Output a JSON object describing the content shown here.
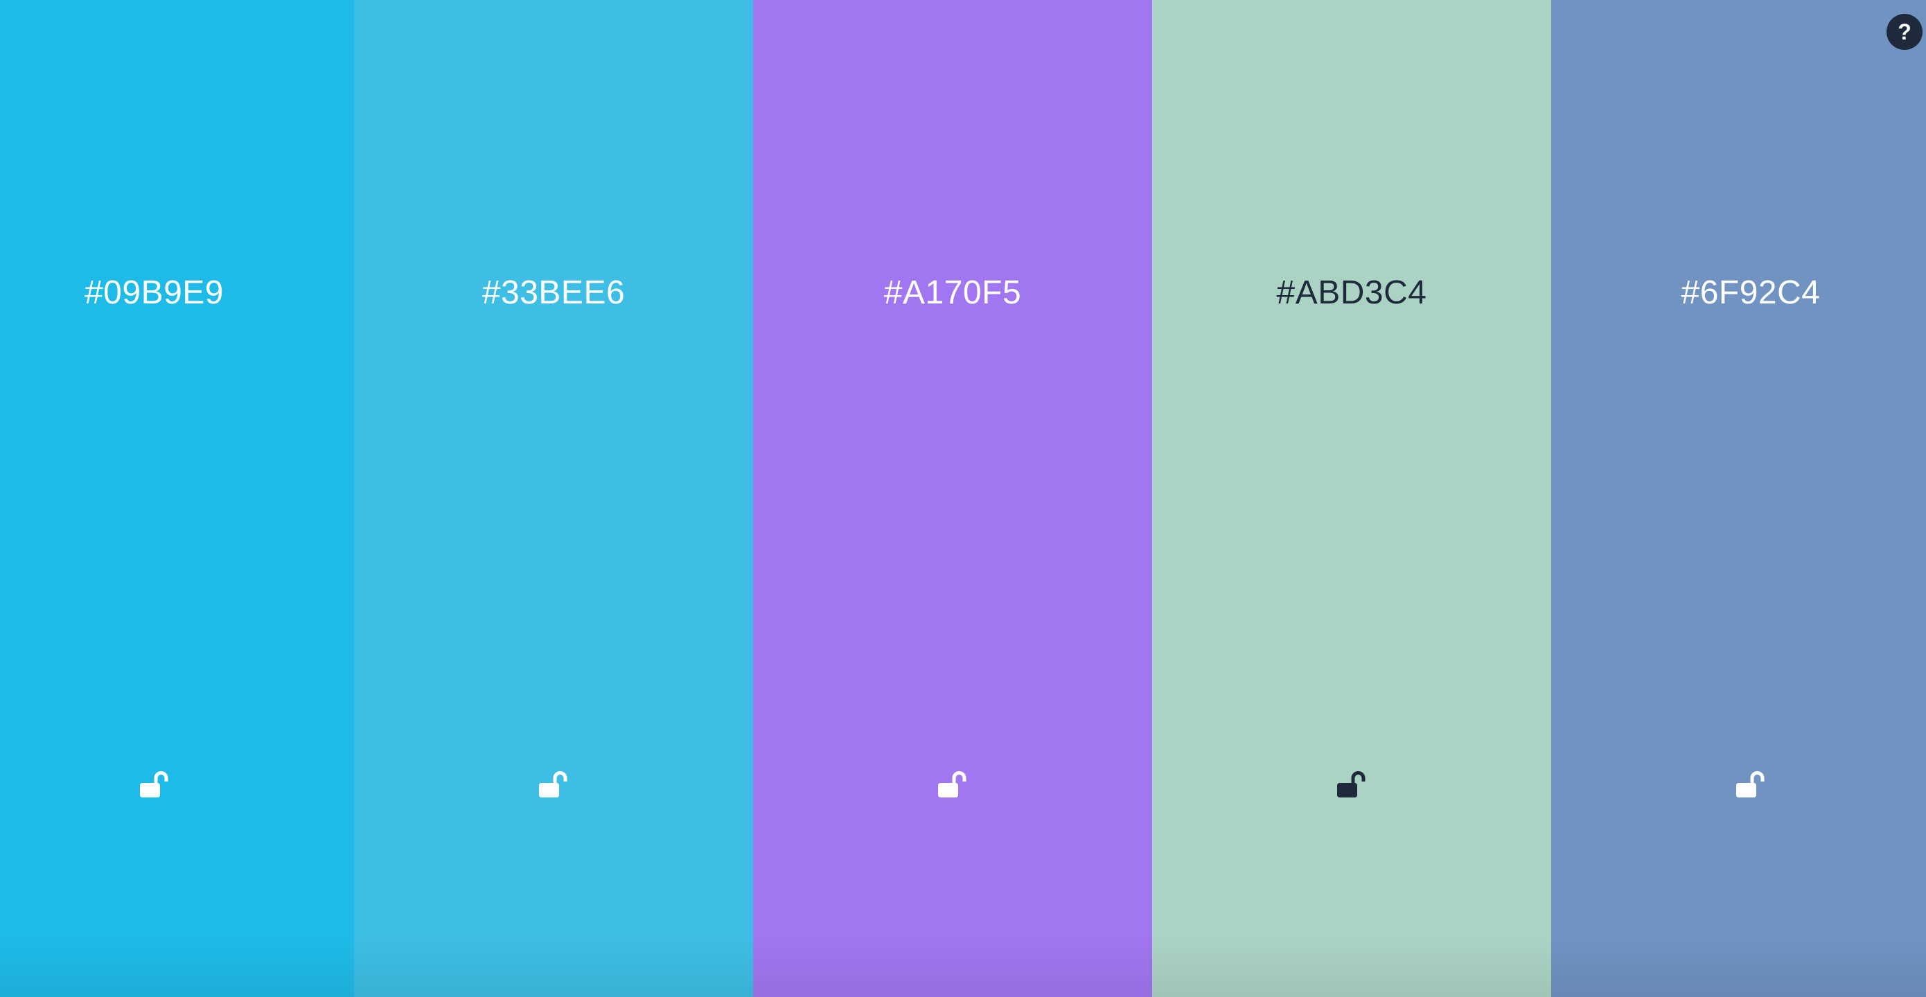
{
  "swatches": [
    {
      "hex": "#09B9E9",
      "background": "#1fbbe8",
      "text_color": "#ffffff",
      "lock_state": "unlocked",
      "lock_icon": "unlock-icon"
    },
    {
      "hex": "#33BEE6",
      "background": "#3ebee5",
      "text_color": "#ffffff",
      "lock_state": "unlocked",
      "lock_icon": "unlock-icon"
    },
    {
      "hex": "#A170F5",
      "background": "#a176f1",
      "text_color": "#ffffff",
      "lock_state": "unlocked",
      "lock_icon": "unlock-icon"
    },
    {
      "hex": "#ABD3C4",
      "background": "#abd3c4",
      "text_color": "#1e293b",
      "lock_state": "unlocked",
      "lock_icon": "unlock-icon"
    },
    {
      "hex": "#6F92C4",
      "background": "#7093c2",
      "text_color": "#ffffff",
      "lock_state": "unlocked",
      "lock_icon": "unlock-icon"
    }
  ],
  "help": {
    "label": "?",
    "icon": "help-icon",
    "background": "#1e293b",
    "text_color": "#ffffff"
  }
}
